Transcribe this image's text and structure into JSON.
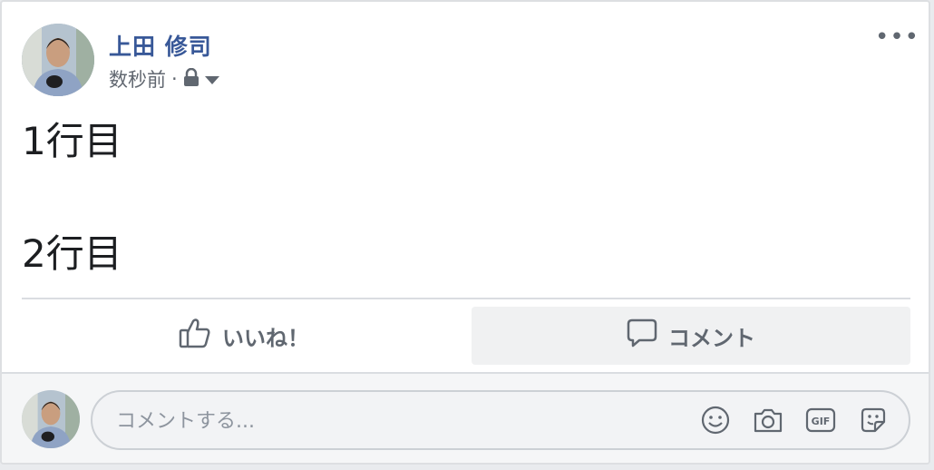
{
  "post": {
    "author": "上田 修司",
    "timestamp": "数秒前",
    "separator": "·",
    "privacy_icon": "lock-icon",
    "more_label": "•••",
    "lines": [
      "1行目",
      "2行目"
    ]
  },
  "actions": {
    "like_label": "いいね！",
    "comment_label": "コメント"
  },
  "composer": {
    "placeholder": "コメントする..."
  },
  "colors": {
    "author": "#385898",
    "meta": "#616770",
    "divider": "#dadde1",
    "comment_button_bg": "#f0f1f2"
  }
}
